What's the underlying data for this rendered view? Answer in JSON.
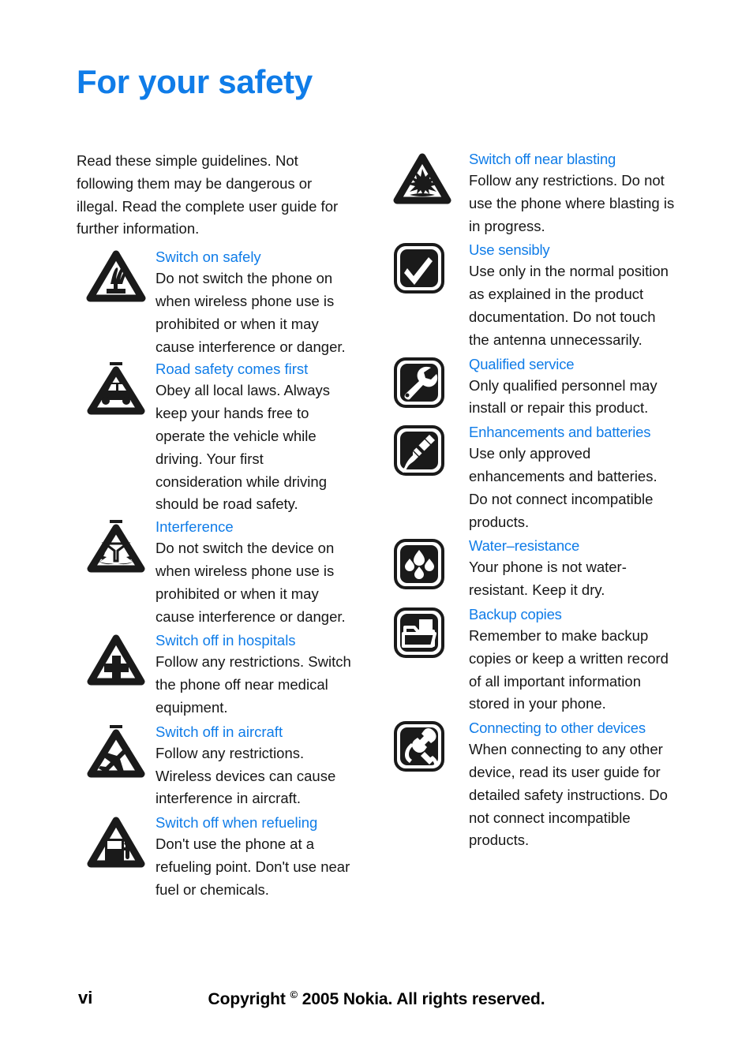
{
  "document": {
    "title": "For your safety",
    "intro": "Read these simple guidelines. Not following them may be dangerous or illegal. Read the complete user guide for further information."
  },
  "colors": {
    "heading_blue": "#0f7ce8",
    "body_black": "#161616",
    "icon_black": "#1a1a1a",
    "page_background": "#ffffff"
  },
  "left_column": {
    "entries": [
      {
        "icon": "switch-on-safely-triangle-icon",
        "title": "Switch on safely",
        "body": "Do not switch the phone on when wireless phone use is prohibited or when it may cause interference or danger."
      },
      {
        "icon": "road-safety-car-triangle-icon",
        "title": "Road safety comes first",
        "body": "Obey all local laws. Always keep your hands free to operate the vehicle while driving. Your first consideration while driving should be road safety."
      },
      {
        "icon": "interference-antenna-triangle-icon",
        "title": "Interference",
        "body": "Do not switch the device on when wireless phone use is prohibited or when it may cause interference or danger."
      },
      {
        "icon": "hospital-cross-triangle-icon",
        "title": "Switch off in hospitals",
        "body": "Follow any restrictions. Switch the phone off near medical equipment."
      },
      {
        "icon": "aircraft-airplane-triangle-icon",
        "title": "Switch off in aircraft",
        "body": "Follow any restrictions. Wireless devices can cause interference in aircraft."
      },
      {
        "icon": "refueling-fuel-pump-triangle-icon",
        "title": "Switch off when refueling",
        "body": "Don't use the phone at a refueling point. Don't use near fuel or chemicals."
      }
    ]
  },
  "right_column": {
    "entries": [
      {
        "icon": "blasting-explosion-triangle-icon",
        "title": "Switch off near blasting",
        "body": "Follow any restrictions. Do not use the phone where blasting is in progress."
      },
      {
        "icon": "use-sensibly-checkmark-icon",
        "title": "Use sensibly",
        "body": "Use only in the normal position as explained in the product documentation. Do not touch the antenna unnecessarily."
      },
      {
        "icon": "qualified-service-wrench-icon",
        "title": "Qualified service",
        "body": "Only qualified personnel may install or repair this product."
      },
      {
        "icon": "enhancements-batteries-icon",
        "title": "Enhancements and batteries",
        "body": "Use only approved enhancements and batteries. Do not connect incompatible products."
      },
      {
        "icon": "water-resistance-droplets-icon",
        "title": "Water–resistance",
        "body": "Your phone is not water-resistant. Keep it dry."
      },
      {
        "icon": "backup-copies-folder-icon",
        "title": "Backup copies",
        "body": "Remember to make backup copies or keep a written record of all important information stored in your phone."
      },
      {
        "icon": "connecting-devices-plugs-icon",
        "title": "Connecting to other devices",
        "body": "When connecting to any other device, read its user guide for detailed safety instructions. Do not connect incompatible products."
      }
    ]
  },
  "footer": {
    "page_number": "vi",
    "copyright_prefix": "Copyright ",
    "copyright_symbol": "©",
    "copyright_suffix": " 2005 Nokia. All rights reserved."
  }
}
